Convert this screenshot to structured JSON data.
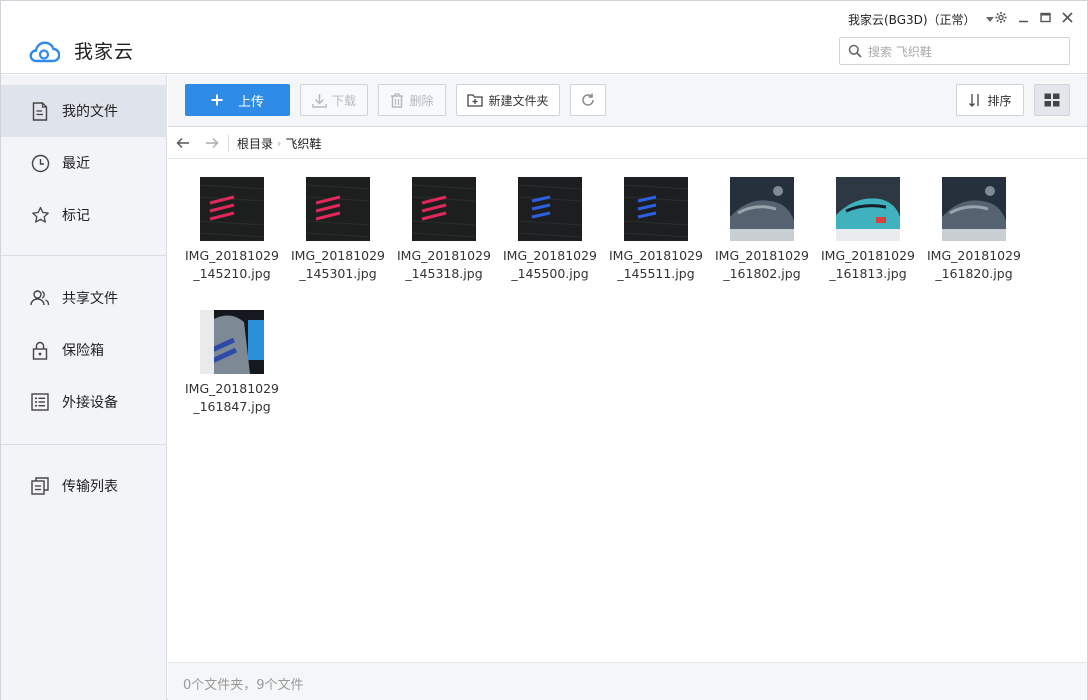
{
  "app": {
    "title": "我家云"
  },
  "user": {
    "label": "我家云(BG3D)（正常）"
  },
  "search": {
    "placeholder": "搜索 飞织鞋"
  },
  "sidebar": {
    "items": [
      {
        "label": "我的文件",
        "icon": "file-icon",
        "active": true
      },
      {
        "label": "最近",
        "icon": "clock-icon"
      },
      {
        "label": "标记",
        "icon": "star-icon"
      },
      {
        "label": "共享文件",
        "icon": "users-icon"
      },
      {
        "label": "保险箱",
        "icon": "lock-icon"
      },
      {
        "label": "外接设备",
        "icon": "list-icon"
      },
      {
        "label": "传输列表",
        "icon": "transfer-icon"
      }
    ]
  },
  "toolbar": {
    "upload_label": "上传",
    "download_label": "下载",
    "delete_label": "删除",
    "new_folder_label": "新建文件夹",
    "sort_label": "排序"
  },
  "breadcrumb": {
    "root": "根目录",
    "current": "飞织鞋"
  },
  "files": [
    {
      "name": "IMG_20181029\n_145210.jpg",
      "thumb": "knit-red"
    },
    {
      "name": "IMG_20181029\n_145301.jpg",
      "thumb": "knit-red"
    },
    {
      "name": "IMG_20181029\n_145318.jpg",
      "thumb": "knit-red"
    },
    {
      "name": "IMG_20181029\n_145500.jpg",
      "thumb": "knit-blue"
    },
    {
      "name": "IMG_20181029\n_145511.jpg",
      "thumb": "knit-blue"
    },
    {
      "name": "IMG_20181029\n_161802.jpg",
      "thumb": "sneaker-grey"
    },
    {
      "name": "IMG_20181029\n_161813.jpg",
      "thumb": "sneaker-teal"
    },
    {
      "name": "IMG_20181029\n_161820.jpg",
      "thumb": "sneaker-grey"
    },
    {
      "name": "IMG_20181029\n_161847.jpg",
      "thumb": "sneaker-blue"
    }
  ],
  "status": {
    "text": "0个文件夹，9个文件"
  },
  "colors": {
    "accent": "#2e8be8",
    "sidebar_bg": "#f2f4f8",
    "active_bg": "#dfe3ec"
  }
}
